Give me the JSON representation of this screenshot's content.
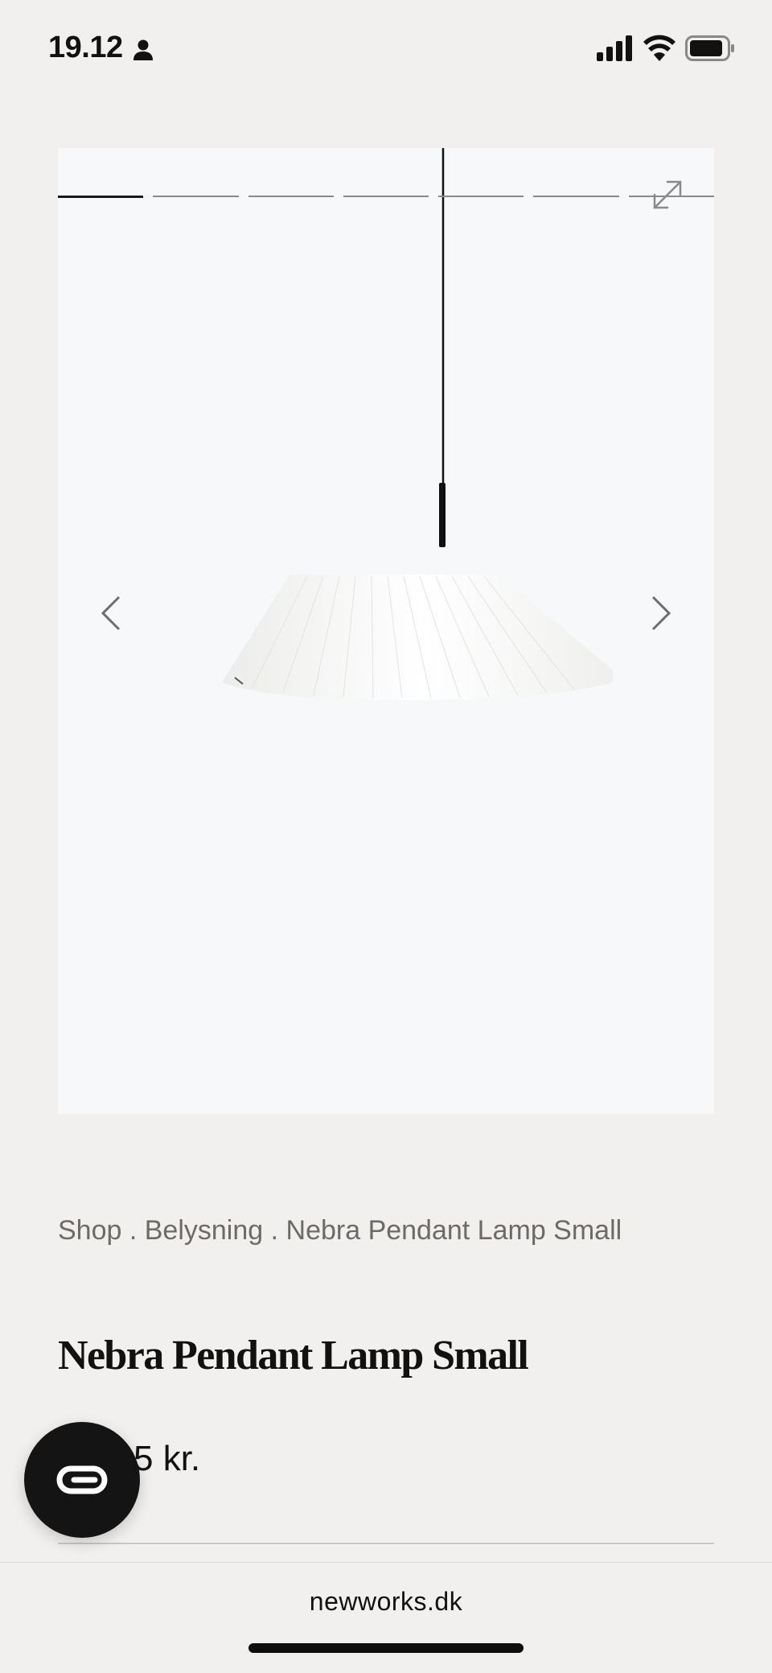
{
  "status_bar": {
    "time": "19.12"
  },
  "gallery": {
    "slide_count": 7,
    "active_slide": 1
  },
  "breadcrumb": {
    "items": [
      "Shop",
      "Belysning",
      "Nebra Pendant Lamp Small"
    ],
    "separator": " . "
  },
  "product": {
    "title": "Nebra Pendant Lamp Small",
    "price": "5 kr."
  },
  "browser": {
    "url": "newworks.dk"
  },
  "icons": {
    "status": [
      "person-icon",
      "signal-icon",
      "wifi-icon",
      "battery-icon"
    ],
    "gallery": [
      "expand-icon",
      "arrow-left-icon",
      "arrow-right-icon"
    ],
    "chat": "chat-icon"
  },
  "colors": {
    "background": "#f1f0ee",
    "gallery_background": "#f7f8f9",
    "breadcrumb_text": "#6e6a66",
    "chat_button": "#141414"
  }
}
